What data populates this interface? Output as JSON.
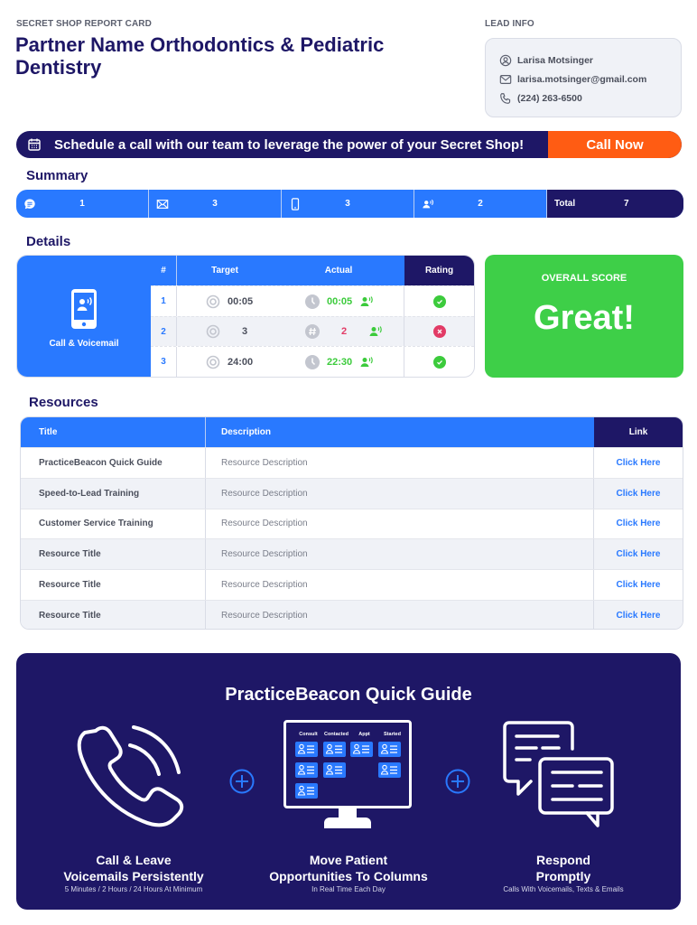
{
  "header": {
    "eyebrow": "SECRET SHOP REPORT CARD",
    "partner_name": "Partner Name Orthodontics & Pediatric Dentistry",
    "lead_info_label": "LEAD INFO"
  },
  "lead": {
    "name": "Larisa Motsinger",
    "email": "larisa.motsinger@gmail.com",
    "phone": "(224) 263-6500"
  },
  "cta": {
    "message": "Schedule a call with our team to leverage the power of your Secret Shop!",
    "button_label": "Call Now",
    "button_color": "#ff5c13"
  },
  "summary": {
    "title": "Summary",
    "items": [
      {
        "icon": "chat-bubble-icon",
        "value": "1"
      },
      {
        "icon": "envelope-icon",
        "value": "3"
      },
      {
        "icon": "mobile-phone-icon",
        "value": "3"
      },
      {
        "icon": "voicemail-icon",
        "value": "2"
      }
    ],
    "total_label": "Total",
    "total_value": "7"
  },
  "details": {
    "title": "Details",
    "category_label": "Call & Voicemail",
    "columns": [
      "#",
      "Target",
      "Actual",
      "Rating"
    ],
    "rows": [
      {
        "num": "1",
        "target": "00:05",
        "actual": "00:05",
        "actual_icon": "clock-icon",
        "status": "pass"
      },
      {
        "num": "2",
        "target": "3",
        "actual": "2",
        "actual_icon": "hash-icon",
        "status": "fail"
      },
      {
        "num": "3",
        "target": "24:00",
        "actual": "22:30",
        "actual_icon": "clock-icon",
        "status": "pass"
      }
    ]
  },
  "score": {
    "label": "OVERALL SCORE",
    "value": "Great!",
    "color": "#3ecf48"
  },
  "resources": {
    "title": "Resources",
    "columns": [
      "Title",
      "Description",
      "Link"
    ],
    "rows": [
      {
        "title": "PracticeBeacon Quick Guide",
        "description": "Resource Description",
        "link": "Click Here"
      },
      {
        "title": "Speed-to-Lead Training",
        "description": "Resource Description",
        "link": "Click Here"
      },
      {
        "title": "Customer Service Training",
        "description": "Resource Description",
        "link": "Click Here"
      },
      {
        "title": "Resource Title",
        "description": "Resource Description",
        "link": "Click Here"
      },
      {
        "title": "Resource Title",
        "description": "Resource Description",
        "link": "Click Here"
      },
      {
        "title": "Resource Title",
        "description": "Resource Description",
        "link": "Click Here"
      }
    ]
  },
  "guide": {
    "title": "PracticeBeacon Quick Guide",
    "board_columns": [
      "Consult",
      "Contacted",
      "Appt",
      "Started"
    ],
    "steps": [
      {
        "heading_1": "Call & Leave",
        "heading_2": "Voicemails Persistently",
        "sub": "5 Minutes / 2 Hours / 24 Hours At Minimum"
      },
      {
        "heading_1": "Move Patient",
        "heading_2": "Opportunities To Columns",
        "sub": "In Real Time Each Day"
      },
      {
        "heading_1": "Respond",
        "heading_2": "Promptly",
        "sub": "Calls With Voicemails, Texts & Emails"
      }
    ]
  },
  "colors": {
    "navy": "#1e1766",
    "blue": "#2979ff",
    "green": "#3ecf48",
    "red": "#e23b66",
    "orange": "#ff5c13"
  }
}
